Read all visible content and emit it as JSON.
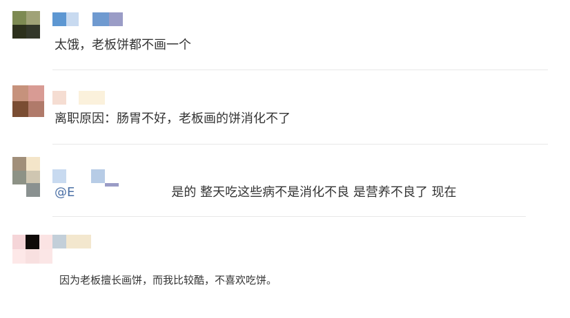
{
  "comments": [
    {
      "avatar_colors": [
        "#7d8a52",
        "#a0a277",
        "#2c301c",
        "#33372a"
      ],
      "name_colors": [
        "#5d97d2",
        "#c8daf0",
        "#ffffff",
        "#6f9ad0",
        "#9a9cc6"
      ],
      "text": "太饿，老板饼都不画一个"
    },
    {
      "avatar_colors": [
        "#c6927c",
        "#d89b94",
        "#7a4d33",
        "#b07a6a"
      ],
      "name_colors": [
        "#f5ddd2",
        "#ffffff",
        "#fbf1dc"
      ],
      "text": "离职原因：肠胃不好，老板画的饼消化不了"
    },
    {
      "avatar_colors": [
        "#a18f7a",
        "#f4e5c9",
        "#8d9286",
        "#cfc6b1"
      ],
      "name_colors": [
        "#c8daf0",
        "#ffffff",
        "#b7cce6"
      ],
      "mention": "@E",
      "text": "是的 整天吃这些病不是消化不良 是营养不良了 现在"
    },
    {
      "avatar_colors": [
        "#f5d5d8",
        "#0f0a08",
        "#fbe3e3",
        "#fde8e8"
      ],
      "name_colors": [
        "#c3cfd9",
        "#f3e7ce"
      ],
      "text": "因为老板擅长画饼，而我比较酷，不喜欢吃饼。"
    }
  ]
}
